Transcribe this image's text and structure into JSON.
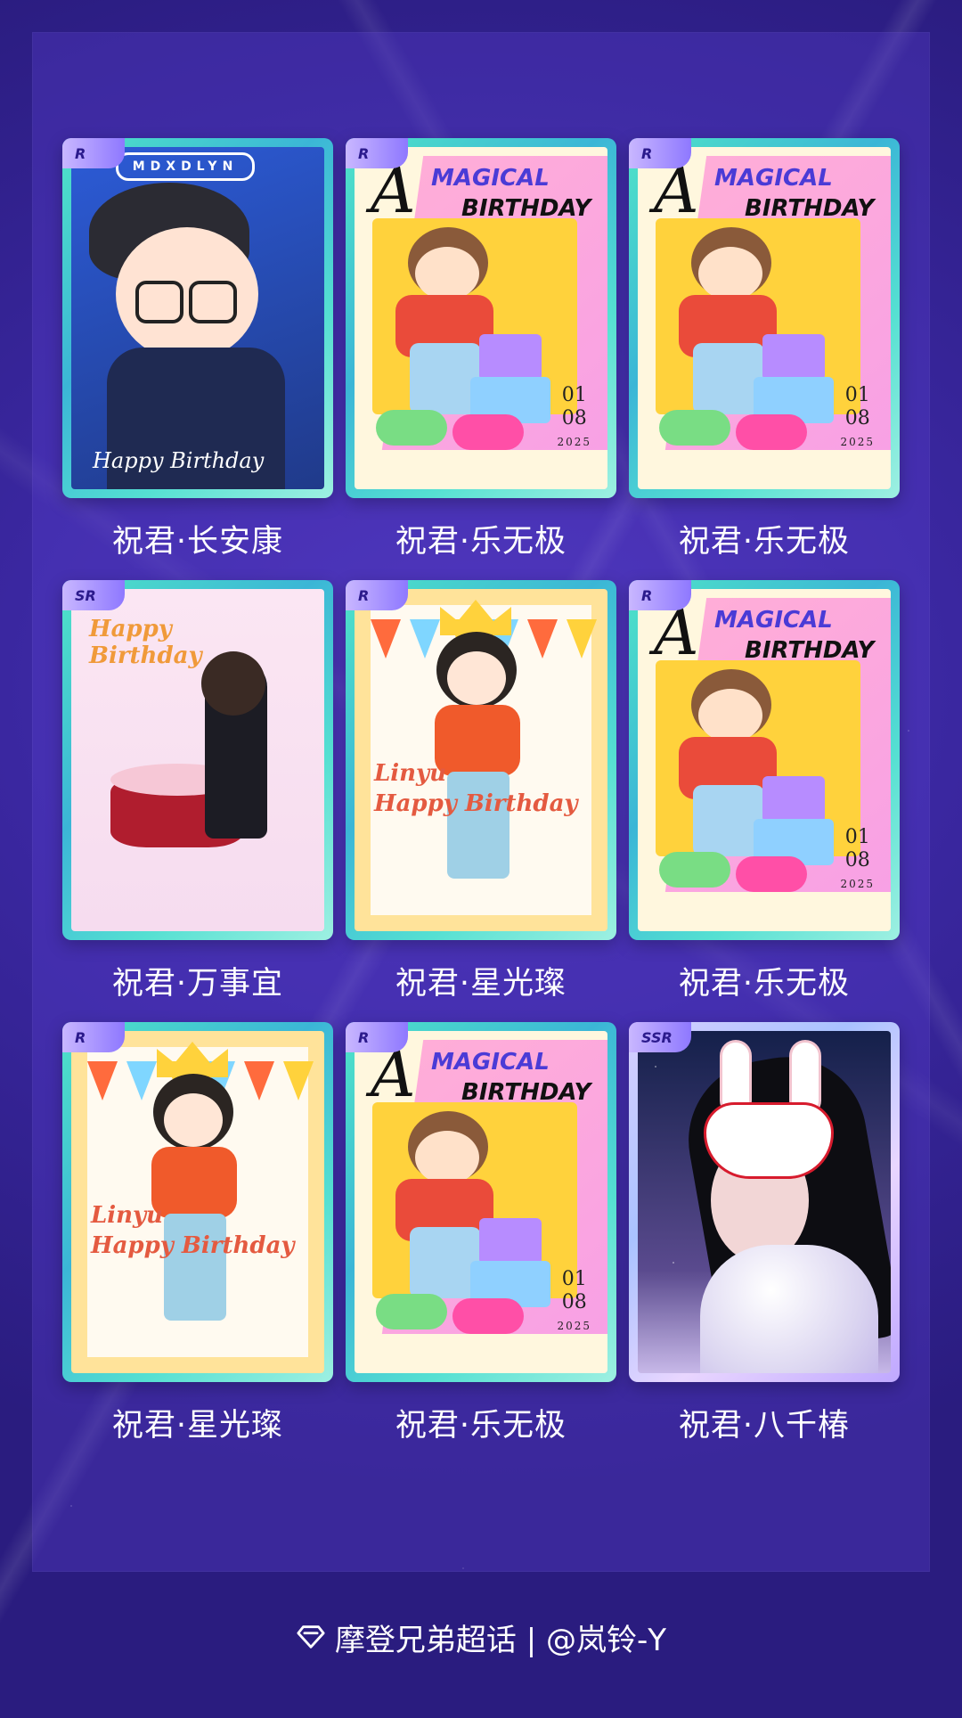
{
  "cards": [
    {
      "rarity": "R",
      "label": "祝君·长安康",
      "art": "chibi-blue",
      "art_text": {
        "tag": "MDXDLYN",
        "script": "Happy Birthday"
      }
    },
    {
      "rarity": "R",
      "label": "祝君·乐无极",
      "art": "magic",
      "art_text": {
        "a": "A",
        "t1": "MAGICAL",
        "t2": "BIRTHDAY",
        "d1": "01",
        "d2": "08",
        "d3": "2025"
      }
    },
    {
      "rarity": "R",
      "label": "祝君·乐无极",
      "art": "magic",
      "art_text": {
        "a": "A",
        "t1": "MAGICAL",
        "t2": "BIRTHDAY",
        "d1": "01",
        "d2": "08",
        "d3": "2025"
      }
    },
    {
      "rarity": "SR",
      "label": "祝君·万事宜",
      "art": "cake",
      "art_text": {
        "hb1": "Happy",
        "hb2": "Birthday"
      }
    },
    {
      "rarity": "R",
      "label": "祝君·星光璨",
      "art": "crown",
      "art_text": {
        "l1": "Linyu",
        "l2": "Happy Birthday"
      }
    },
    {
      "rarity": "R",
      "label": "祝君·乐无极",
      "art": "magic",
      "art_text": {
        "a": "A",
        "t1": "MAGICAL",
        "t2": "BIRTHDAY",
        "d1": "01",
        "d2": "08",
        "d3": "2025"
      }
    },
    {
      "rarity": "R",
      "label": "祝君·星光璨",
      "art": "crown",
      "art_text": {
        "l1": "Linyu",
        "l2": "Happy Birthday"
      }
    },
    {
      "rarity": "R",
      "label": "祝君·乐无极",
      "art": "magic",
      "art_text": {
        "a": "A",
        "t1": "MAGICAL",
        "t2": "BIRTHDAY",
        "d1": "01",
        "d2": "08",
        "d3": "2025"
      }
    },
    {
      "rarity": "SSR",
      "label": "祝君·八千椿",
      "art": "mask",
      "art_text": {}
    }
  ],
  "footer": {
    "icon": "diamond-icon",
    "text": "摩登兄弟超话 | @岚铃-Y"
  },
  "colors": {
    "background": "#2c1f86",
    "card_frame": "#4fe3c8",
    "badge": "#8e78ff"
  }
}
